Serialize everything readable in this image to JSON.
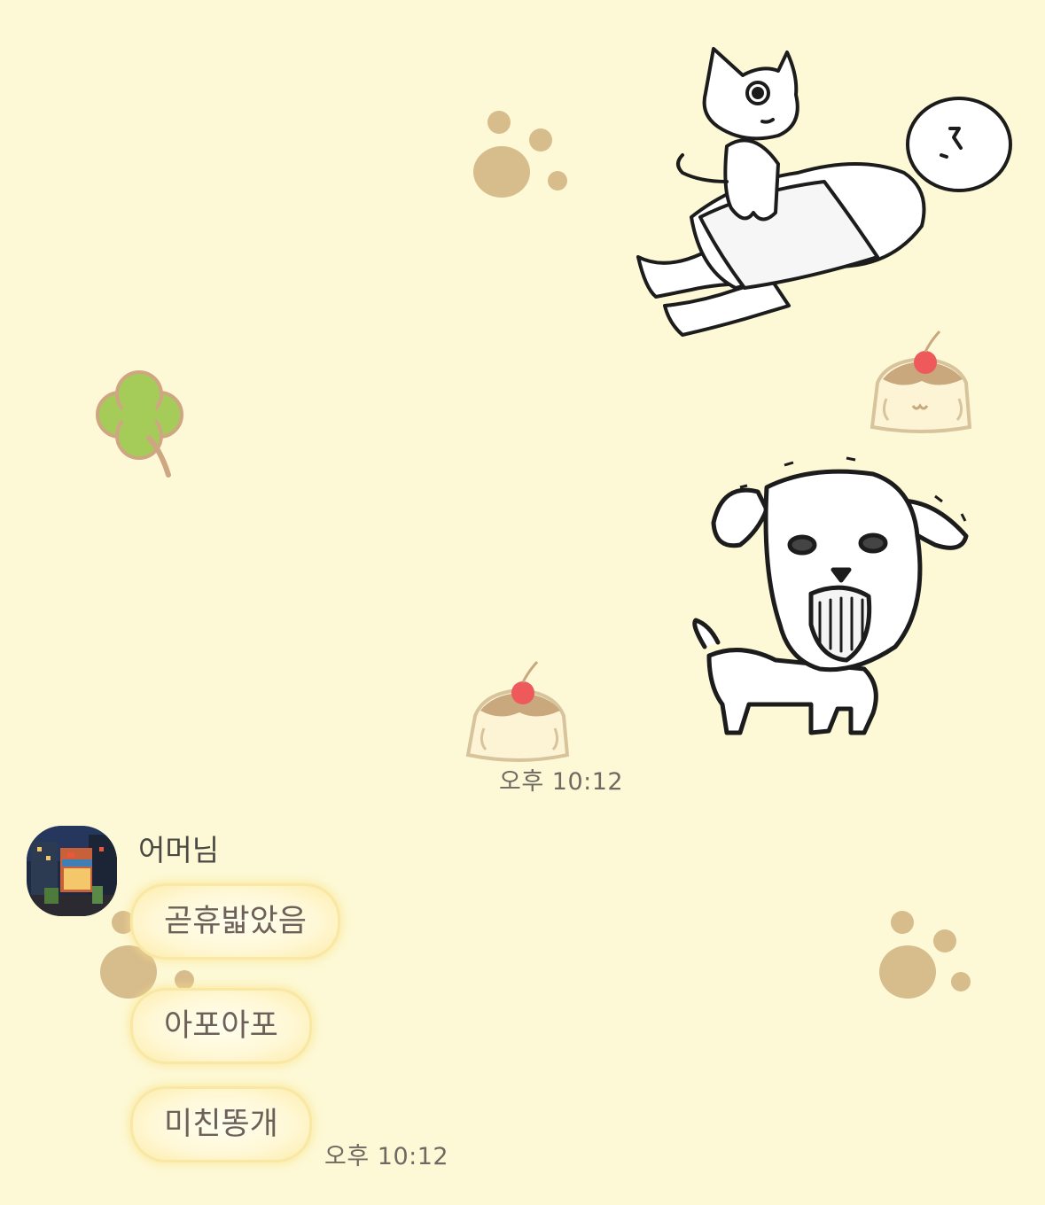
{
  "colors": {
    "background": "#fdf9d6",
    "bubble": "#fff8d6",
    "paw_print": "#d3b685",
    "clover": "#a5cc58"
  },
  "stickers": [
    {
      "name": "cat-on-person-sticker",
      "description_icon": "cat-riding-person-icon"
    },
    {
      "name": "angry-dog-sticker",
      "description_icon": "angry-dog-icon"
    }
  ],
  "outgoing": {
    "timestamp": "오후 10:12"
  },
  "incoming": {
    "sender": "어머님",
    "avatar_icon": "night-shop-avatar",
    "messages": [
      {
        "text": "곧휴밟았음"
      },
      {
        "text": "아포아포"
      },
      {
        "text": "미친똥개"
      }
    ],
    "timestamp": "오후 10:12"
  }
}
